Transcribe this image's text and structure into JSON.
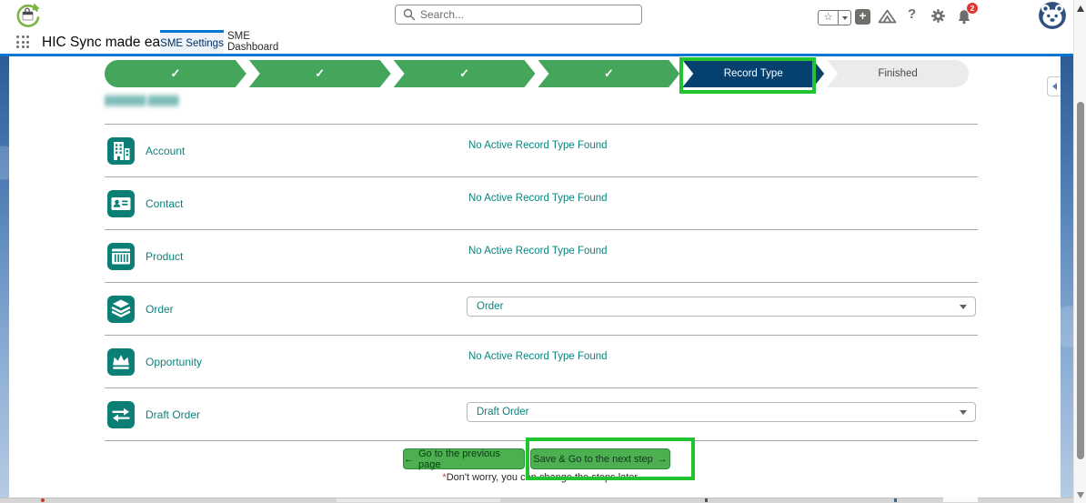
{
  "header": {
    "app_name": "HIC Sync made easy",
    "search_placeholder": "Search...",
    "tabs": [
      {
        "label": "SME Settings"
      },
      {
        "label": "SME Dashboard"
      }
    ],
    "notification_badge": "2"
  },
  "stepper": {
    "done_check": "✓",
    "current_step": "Record Type",
    "final_step": "Finished"
  },
  "section": {
    "redacted_heading": "████████ ██████"
  },
  "rows": [
    {
      "object": "Account",
      "status": "No Active Record Type Found"
    },
    {
      "object": "Contact",
      "status": "No Active Record Type Found"
    },
    {
      "object": "Product",
      "status": "No Active Record Type Found"
    },
    {
      "object": "Order",
      "selected": "Order"
    },
    {
      "object": "Opportunity",
      "status": "No Active Record Type Found"
    },
    {
      "object": "Draft Order",
      "selected": "Draft Order"
    }
  ],
  "footer": {
    "prev_arrow": "←",
    "prev_label": "Go to the previous page",
    "next_label": "Save & Go to the next step",
    "next_arrow": "→",
    "note_mark": "*",
    "note": "Don't worry, you can change the steps later."
  },
  "colors": {
    "brand_blue": "#0176d3",
    "step_green": "#43a65a",
    "current_step_navy": "#05406e",
    "teal": "#0d827c",
    "annotation_green": "#1fc42e",
    "button_green": "#4cb051",
    "badge_red": "#e3342f"
  }
}
